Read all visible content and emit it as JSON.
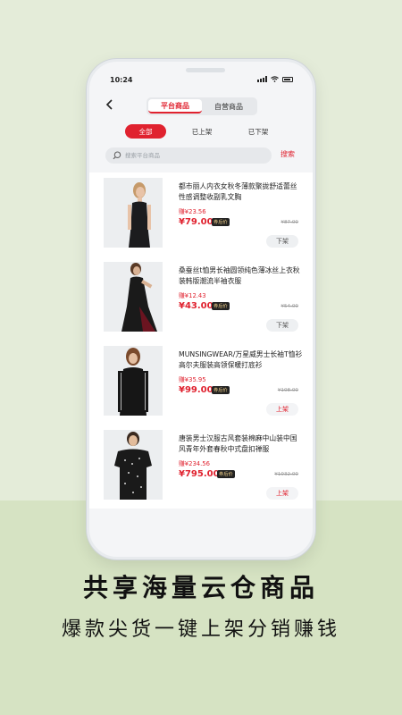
{
  "status_bar": {
    "time": "10:24"
  },
  "header": {
    "tabs": [
      {
        "label": "平台商品",
        "active": true
      },
      {
        "label": "自营商品",
        "active": false
      }
    ]
  },
  "filters": [
    {
      "label": "全部",
      "active": true
    },
    {
      "label": "已上架",
      "active": false
    },
    {
      "label": "已下架",
      "active": false
    }
  ],
  "search": {
    "placeholder": "搜索平台商品",
    "button_label": "搜索"
  },
  "products": [
    {
      "title": "都市丽人内衣女秋冬薄款聚拢舒适蕾丝性感调整收副乳文胸",
      "earn": "赚¥23.56",
      "price": "¥79.00",
      "badge": "券后价",
      "orig_price": "¥87.00",
      "action": "下架",
      "image": "woman-black-dress"
    },
    {
      "title": "桑蚕丝t恤男长袖圆领纯色薄冰丝上衣秋装韩版潮流半袖衣服",
      "earn": "赚¥12.43",
      "price": "¥43.00",
      "badge": "券后价",
      "orig_price": "¥54.00",
      "action": "下架",
      "image": "woman-long-dress"
    },
    {
      "title": "MUNSINGWEAR/万星威男士长袖T恤衫高尔夫服装高领保暖打底衫",
      "earn": "赚¥35.95",
      "price": "¥99.00",
      "badge": "券后价",
      "orig_price": "¥108.00",
      "action": "上架",
      "image": "woman-black-sweater"
    },
    {
      "title": "唐装男士汉服古风套装棉麻中山装中国风青年外套春秋中式盘扣禅服",
      "earn": "赚¥234.56",
      "price": "¥795.00",
      "badge": "券后价",
      "orig_price": "¥1032.00",
      "action": "上架",
      "image": "woman-printed-tee"
    }
  ],
  "promo": {
    "headline": "共享海量云仓商品",
    "subline": "爆款尖货一键上架分销赚钱"
  },
  "colors": {
    "accent": "#e0222f",
    "background": "#e4ecd9",
    "band": "#d6e3c3"
  }
}
